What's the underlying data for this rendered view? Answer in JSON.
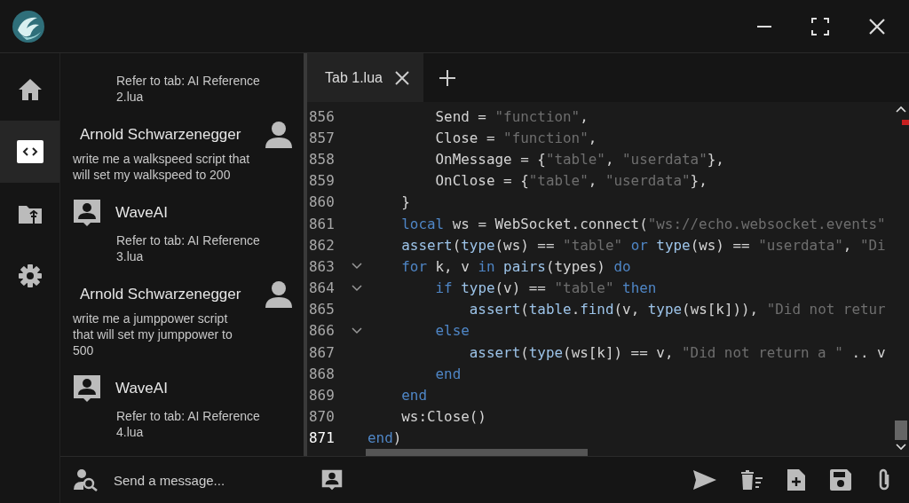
{
  "nav": [
    {
      "kind": "home",
      "selected": false
    },
    {
      "kind": "code",
      "selected": true
    },
    {
      "kind": "folder",
      "selected": false
    },
    {
      "kind": "settings",
      "selected": false
    }
  ],
  "chat": {
    "messages": [
      {
        "kind": "ai",
        "text": "Refer to tab: AI Reference 2.lua"
      },
      {
        "kind": "user",
        "author": "Arnold Schwarzenegger",
        "text": "write me a walkspeed script that will set my walkspeed to 200"
      },
      {
        "kind": "ai",
        "author": "WaveAI",
        "text": "Refer to tab: AI Reference 3.lua"
      },
      {
        "kind": "user",
        "author": "Arnold Schwarzenegger",
        "text": "write me a jumppower script that will set my jumppower to 500"
      },
      {
        "kind": "ai",
        "author": "WaveAI",
        "text": "Refer to tab: AI Reference 4.lua"
      }
    ],
    "input": {
      "placeholder": "Send a message..."
    }
  },
  "tabs": [
    {
      "label": "Tab 1.lua",
      "selected": true
    }
  ],
  "editor": {
    "lines": [
      {
        "number": "856",
        "fold": false,
        "current": false,
        "tokens": [
          {
            "kind": "plain",
            "text": "        Send = "
          },
          {
            "kind": "string",
            "text": "\"function\""
          },
          {
            "kind": "plain",
            "text": ","
          }
        ]
      },
      {
        "number": "857",
        "fold": false,
        "current": false,
        "tokens": [
          {
            "kind": "plain",
            "text": "        Close = "
          },
          {
            "kind": "string",
            "text": "\"function\""
          },
          {
            "kind": "plain",
            "text": ","
          }
        ]
      },
      {
        "number": "858",
        "fold": false,
        "current": false,
        "tokens": [
          {
            "kind": "plain",
            "text": "        OnMessage = {"
          },
          {
            "kind": "string",
            "text": "\"table\""
          },
          {
            "kind": "plain",
            "text": ", "
          },
          {
            "kind": "string",
            "text": "\"userdata\""
          },
          {
            "kind": "plain",
            "text": "},"
          }
        ]
      },
      {
        "number": "859",
        "fold": false,
        "current": false,
        "tokens": [
          {
            "kind": "plain",
            "text": "        OnClose = {"
          },
          {
            "kind": "string",
            "text": "\"table\""
          },
          {
            "kind": "plain",
            "text": ", "
          },
          {
            "kind": "string",
            "text": "\"userdata\""
          },
          {
            "kind": "plain",
            "text": "},"
          }
        ]
      },
      {
        "number": "860",
        "fold": false,
        "current": false,
        "tokens": [
          {
            "kind": "plain",
            "text": "    }"
          }
        ]
      },
      {
        "number": "861",
        "fold": false,
        "current": false,
        "tokens": [
          {
            "kind": "keyword",
            "text": "    local"
          },
          {
            "kind": "plain",
            "text": " ws = WebSocket.connect("
          },
          {
            "kind": "string",
            "text": "\"ws://echo.websocket.events\""
          }
        ]
      },
      {
        "number": "862",
        "fold": false,
        "current": false,
        "tokens": [
          {
            "kind": "function",
            "text": "    assert"
          },
          {
            "kind": "plain",
            "text": "("
          },
          {
            "kind": "function",
            "text": "type"
          },
          {
            "kind": "plain",
            "text": "(ws) == "
          },
          {
            "kind": "string",
            "text": "\"table\""
          },
          {
            "kind": "keyword",
            "text": " or "
          },
          {
            "kind": "function",
            "text": "type"
          },
          {
            "kind": "plain",
            "text": "(ws) == "
          },
          {
            "kind": "string",
            "text": "\"userdata\""
          },
          {
            "kind": "plain",
            "text": ", "
          },
          {
            "kind": "string",
            "text": "\"Di"
          }
        ]
      },
      {
        "number": "863",
        "fold": true,
        "current": false,
        "tokens": [
          {
            "kind": "keyword",
            "text": "    for"
          },
          {
            "kind": "plain",
            "text": " k, v "
          },
          {
            "kind": "keyword",
            "text": "in "
          },
          {
            "kind": "function",
            "text": "pairs"
          },
          {
            "kind": "plain",
            "text": "(types) "
          },
          {
            "kind": "keyword",
            "text": "do"
          }
        ]
      },
      {
        "number": "864",
        "fold": true,
        "current": false,
        "tokens": [
          {
            "kind": "keyword",
            "text": "        if "
          },
          {
            "kind": "function",
            "text": "type"
          },
          {
            "kind": "plain",
            "text": "(v) == "
          },
          {
            "kind": "string",
            "text": "\"table\""
          },
          {
            "kind": "keyword",
            "text": " then"
          }
        ]
      },
      {
        "number": "865",
        "fold": false,
        "current": false,
        "tokens": [
          {
            "kind": "function",
            "text": "            assert"
          },
          {
            "kind": "plain",
            "text": "("
          },
          {
            "kind": "function",
            "text": "table"
          },
          {
            "kind": "plain",
            "text": "."
          },
          {
            "kind": "function",
            "text": "find"
          },
          {
            "kind": "plain",
            "text": "(v, "
          },
          {
            "kind": "function",
            "text": "type"
          },
          {
            "kind": "plain",
            "text": "(ws[k])), "
          },
          {
            "kind": "string",
            "text": "\"Did not retur"
          }
        ]
      },
      {
        "number": "866",
        "fold": true,
        "current": false,
        "tokens": [
          {
            "kind": "keyword",
            "text": "        else"
          }
        ]
      },
      {
        "number": "867",
        "fold": false,
        "current": false,
        "tokens": [
          {
            "kind": "function",
            "text": "            assert"
          },
          {
            "kind": "plain",
            "text": "("
          },
          {
            "kind": "function",
            "text": "type"
          },
          {
            "kind": "plain",
            "text": "(ws[k]) == v, "
          },
          {
            "kind": "string",
            "text": "\"Did not return a \""
          },
          {
            "kind": "plain",
            "text": " .. v"
          }
        ]
      },
      {
        "number": "868",
        "fold": false,
        "current": false,
        "tokens": [
          {
            "kind": "keyword",
            "text": "        end"
          }
        ]
      },
      {
        "number": "869",
        "fold": false,
        "current": false,
        "tokens": [
          {
            "kind": "keyword",
            "text": "    end"
          }
        ]
      },
      {
        "number": "870",
        "fold": false,
        "current": false,
        "tokens": [
          {
            "kind": "plain",
            "text": "    ws:Close()"
          }
        ]
      },
      {
        "number": "871",
        "fold": false,
        "current": true,
        "tokens": [
          {
            "kind": "keyword",
            "text": "end"
          },
          {
            "kind": "plain",
            "text": ")"
          }
        ]
      }
    ]
  }
}
